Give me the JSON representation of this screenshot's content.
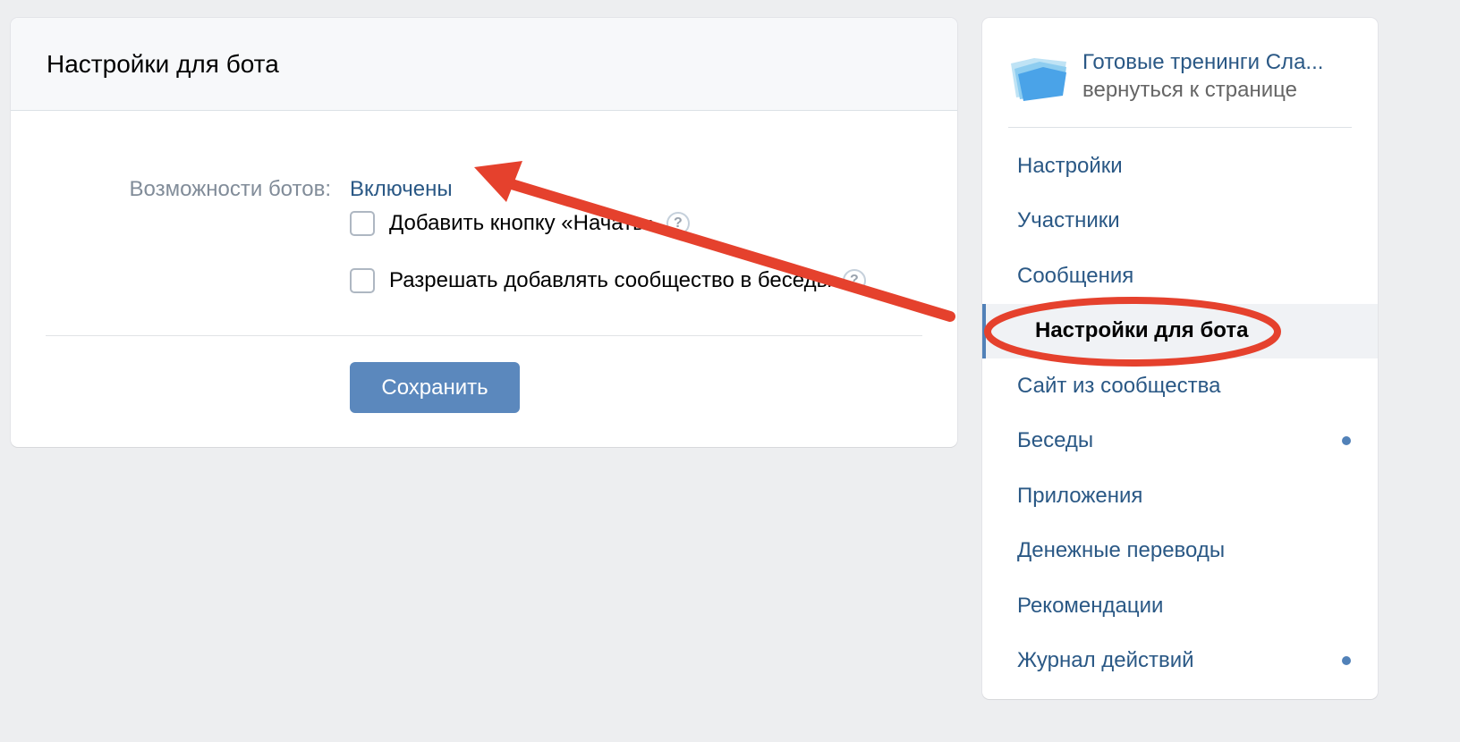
{
  "main": {
    "title": "Настройки для бота",
    "bots_label": "Возможности ботов:",
    "bots_value": "Включены",
    "checkboxes": [
      {
        "label": "Добавить кнопку «Начать»",
        "checked": false
      },
      {
        "label": "Разрешать добавлять сообщество в беседы",
        "checked": false
      }
    ],
    "help_glyph": "?",
    "save_label": "Сохранить"
  },
  "sidebar": {
    "community_name": "Готовые тренинги Сла...",
    "back_link": "вернуться к странице",
    "items": [
      {
        "label": "Настройки",
        "active": false,
        "dot": false
      },
      {
        "label": "Участники",
        "active": false,
        "dot": false
      },
      {
        "label": "Сообщения",
        "active": false,
        "dot": false
      },
      {
        "label": "Настройки для бота",
        "active": true,
        "dot": false
      },
      {
        "label": "Сайт из сообщества",
        "active": false,
        "dot": false
      },
      {
        "label": "Беседы",
        "active": false,
        "dot": true
      },
      {
        "label": "Приложения",
        "active": false,
        "dot": false
      },
      {
        "label": "Денежные переводы",
        "active": false,
        "dot": false
      },
      {
        "label": "Рекомендации",
        "active": false,
        "dot": false
      },
      {
        "label": "Журнал действий",
        "active": false,
        "dot": true
      }
    ]
  },
  "colors": {
    "accent": "#5181b8",
    "link": "#2a5885",
    "button": "#5b88bd",
    "annotation_red": "#e5412d"
  },
  "icons": [
    "folder-logo-icon",
    "help-icon",
    "notification-dot-icon"
  ]
}
